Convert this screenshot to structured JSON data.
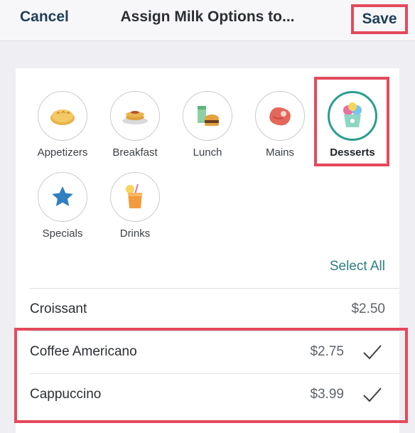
{
  "navbar": {
    "cancel_label": "Cancel",
    "title": "Assign Milk Options to...",
    "save_label": "Save"
  },
  "categories": [
    {
      "label": "Appetizers",
      "icon": "bread-icon",
      "selected": false
    },
    {
      "label": "Breakfast",
      "icon": "pancake-icon",
      "selected": false
    },
    {
      "label": "Lunch",
      "icon": "burger-drink-icon",
      "selected": false
    },
    {
      "label": "Mains",
      "icon": "steak-icon",
      "selected": false
    },
    {
      "label": "Desserts",
      "icon": "ice-cream-icon",
      "selected": true
    },
    {
      "label": "Specials",
      "icon": "star-icon",
      "selected": false
    },
    {
      "label": "Drinks",
      "icon": "juice-icon",
      "selected": false
    }
  ],
  "select_all_label": "Select All",
  "items": [
    {
      "name": "Croissant",
      "price": "$2.50",
      "checked": false
    },
    {
      "name": "Coffee Americano",
      "price": "$2.75",
      "checked": true
    },
    {
      "name": "Cappuccino",
      "price": "$3.99",
      "checked": true
    }
  ],
  "colors": {
    "accent": "#2a9d8f",
    "highlight": "#e4495c",
    "link": "#2c7f86"
  }
}
